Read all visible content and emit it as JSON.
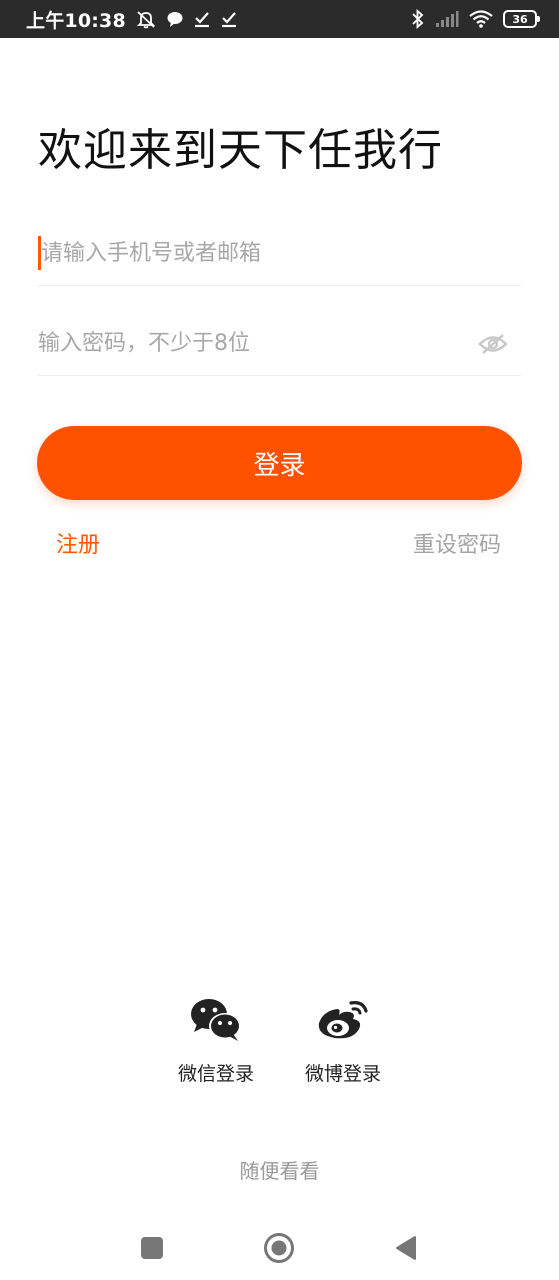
{
  "status_bar": {
    "time": "上午10:38",
    "battery": "36"
  },
  "login": {
    "title": "欢迎来到天下任我行",
    "phone_placeholder": "请输入手机号或者邮箱",
    "password_placeholder": "输入密码，不少于8位",
    "login_button": "登录",
    "register_link": "注册",
    "reset_link": "重设密码"
  },
  "social": {
    "wechat_label": "微信登录",
    "weibo_label": "微博登录"
  },
  "browse_link": "随便看看",
  "colors": {
    "accent": "#ff5200",
    "status_bar_bg": "#2b2b2b",
    "muted_text": "#a4a4a4"
  },
  "icons": {
    "status_left": [
      "mute-bell-icon",
      "chat-bubble-icon",
      "check-download-icon",
      "check-download-icon"
    ],
    "status_right": [
      "bluetooth-icon",
      "signal-icon",
      "wifi-icon",
      "battery-icon"
    ],
    "password_toggle": "eye-hidden-icon",
    "nav": [
      "recents-square-icon",
      "home-circle-icon",
      "back-triangle-icon"
    ]
  }
}
